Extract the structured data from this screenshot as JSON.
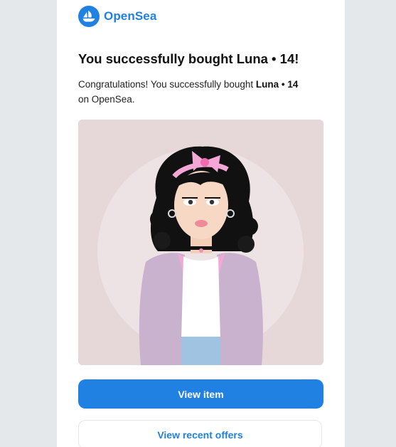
{
  "brand": {
    "name": "OpenSea",
    "color": "#2081e2"
  },
  "email": {
    "title": "You successfully bought Luna • 14!",
    "message_prefix": "Congratulations! You successfully bought ",
    "item_name": "Luna • 14",
    "message_suffix": "on OpenSea."
  },
  "nft_image": {
    "subject": "illustrated girl with curly black hair, pink bow headband, white top and lilac jacket"
  },
  "actions": {
    "view_item": "View item",
    "view_offers": "View recent offers"
  }
}
